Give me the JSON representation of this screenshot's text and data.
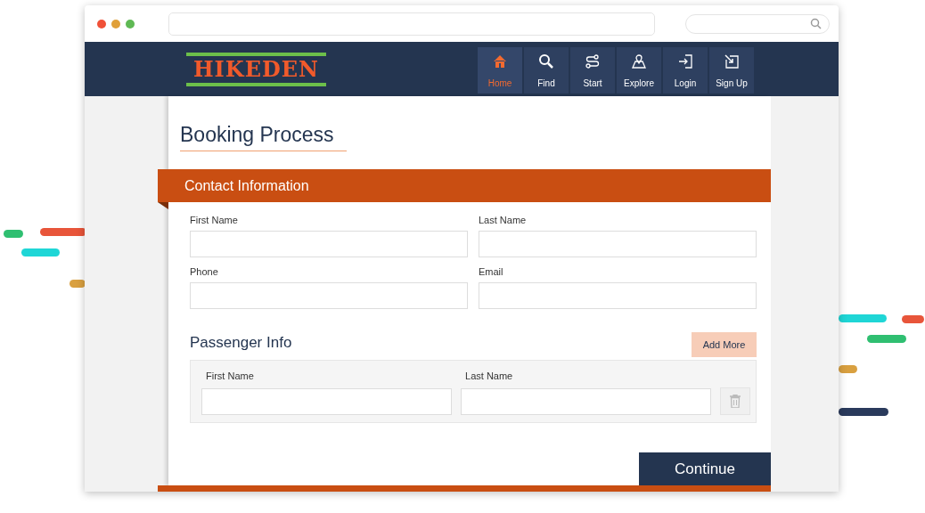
{
  "logo": {
    "text": "HIKEDEN"
  },
  "nav": [
    {
      "label": "Home",
      "selected": true
    },
    {
      "label": "Find",
      "selected": false
    },
    {
      "label": "Start",
      "selected": false
    },
    {
      "label": "Explore",
      "selected": false
    },
    {
      "label": "Login",
      "selected": false
    },
    {
      "label": "Sign Up",
      "selected": false
    }
  ],
  "page_title": "Booking Process",
  "contact": {
    "title": "Contact Information",
    "fields": [
      {
        "label": "First Name"
      },
      {
        "label": "Last Name"
      },
      {
        "label": "Phone"
      },
      {
        "label": "Email"
      }
    ]
  },
  "passengers": {
    "title": "Passenger Info",
    "add_button": "Add More",
    "rows": [
      {
        "fields": [
          {
            "label": "First Name"
          },
          {
            "label": "Last Name"
          }
        ]
      }
    ]
  },
  "continue_button": "Continue"
}
